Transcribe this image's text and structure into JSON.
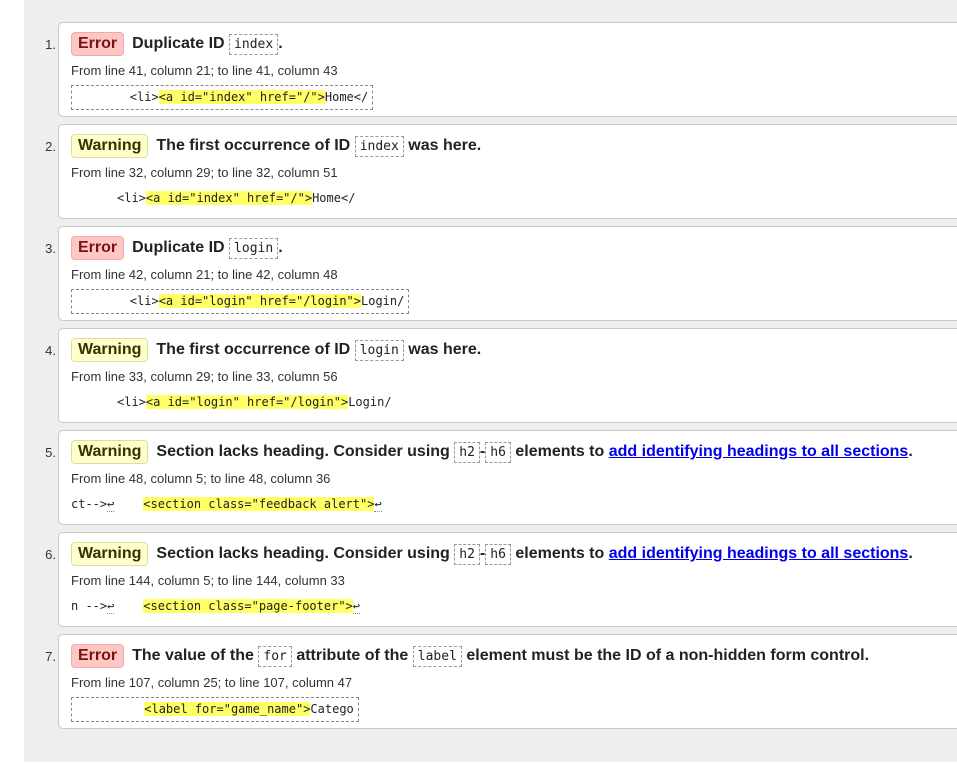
{
  "messages": [
    {
      "num": "1.",
      "type": "error",
      "badge": "Error",
      "text_a": "Duplicate ID",
      "code_a": "index",
      "tail": ".",
      "location": "From line 41, column 21; to line 41, column 43",
      "extract_pre": "        <li>",
      "extract_hl": "<a id=\"index\" href=\"/\">",
      "extract_post": "Home</"
    },
    {
      "num": "2.",
      "type": "warning",
      "badge": "Warning",
      "text_a": "The first occurrence of ID",
      "code_a": "index",
      "text_b": "was here.",
      "location": "From line 32, column 29; to line 32, column 51",
      "extract_pre": "<li>",
      "extract_hl": "<a id=\"index\" href=\"/\">",
      "extract_post": "Home</"
    },
    {
      "num": "3.",
      "type": "error",
      "badge": "Error",
      "text_a": "Duplicate ID",
      "code_a": "login",
      "tail": ".",
      "location": "From line 42, column 21; to line 42, column 48",
      "extract_pre": "        <li>",
      "extract_hl": "<a id=\"login\" href=\"/login\">",
      "extract_post": "Login/"
    },
    {
      "num": "4.",
      "type": "warning",
      "badge": "Warning",
      "text_a": "The first occurrence of ID",
      "code_a": "login",
      "text_b": "was here.",
      "location": "From line 33, column 29; to line 33, column 56",
      "extract_pre": "<li>",
      "extract_hl": "<a id=\"login\" href=\"/login\">",
      "extract_post": "Login/"
    },
    {
      "num": "5.",
      "type": "warning",
      "badge": "Warning",
      "text_a": "Section lacks heading. Consider using",
      "code_a": "h2",
      "dash": "-",
      "code_b": "h6",
      "text_b": "elements to",
      "link": "add identifying headings to all sections",
      "tail": ".",
      "location": "From line 48, column 5; to line 48, column 36",
      "extract_pre": "ct-->",
      "extract_ret1": "↩",
      "extract_gap": "    ",
      "extract_hl": "<section class=\"feedback alert\">",
      "extract_ret2": "↩"
    },
    {
      "num": "6.",
      "type": "warning",
      "badge": "Warning",
      "text_a": "Section lacks heading. Consider using",
      "code_a": "h2",
      "dash": "-",
      "code_b": "h6",
      "text_b": "elements to",
      "link": "add identifying headings to all sections",
      "tail": ".",
      "location": "From line 144, column 5; to line 144, column 33",
      "extract_pre": "n -->",
      "extract_ret1": "↩",
      "extract_gap": "    ",
      "extract_hl": "<section class=\"page-footer\">",
      "extract_ret2": "↩"
    },
    {
      "num": "7.",
      "type": "error",
      "badge": "Error",
      "text_a": "The value of the",
      "code_a": "for",
      "text_b": "attribute of the",
      "code_b": "label",
      "text_c": "element must be the ID of a non-hidden form control.",
      "location": "From line 107, column 25; to line 107, column 47",
      "extract_pre": "",
      "extract_hl": "<label for=\"game_name\">",
      "extract_post": "Catego",
      "extract_indent": "          "
    }
  ]
}
